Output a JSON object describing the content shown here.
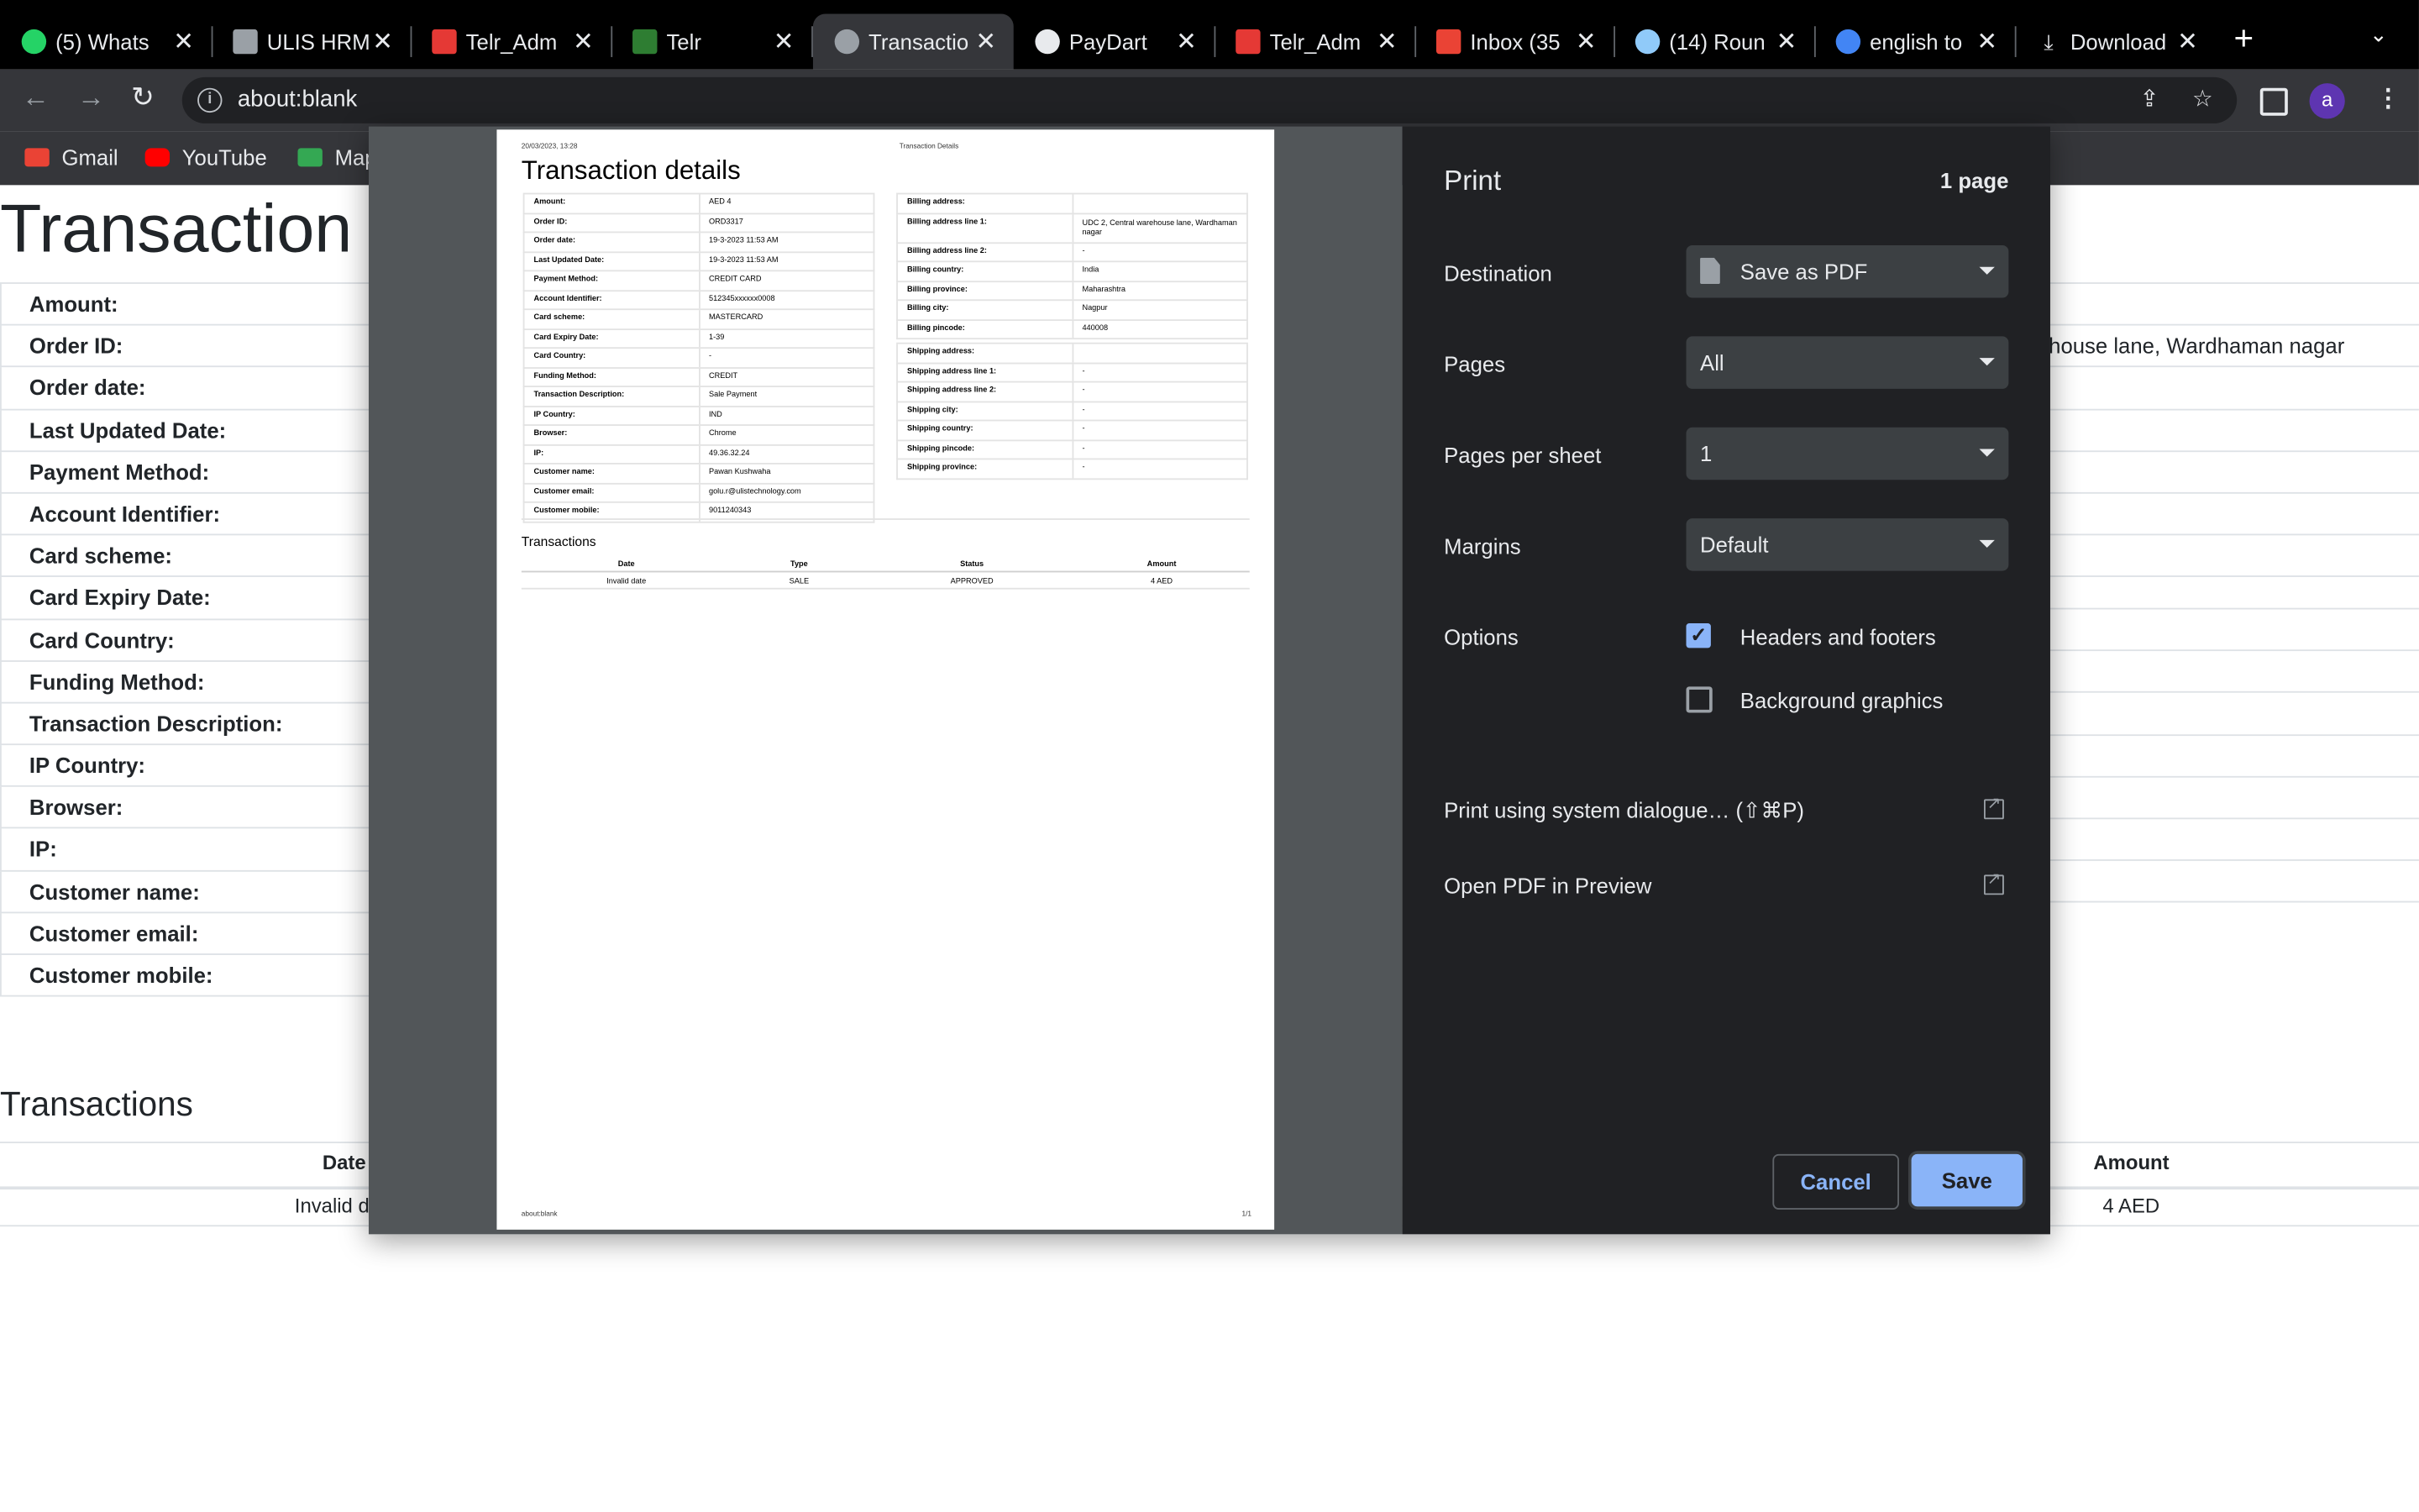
{
  "tabs": [
    {
      "title": "(5) Whats",
      "color": "#25d366",
      "active": false
    },
    {
      "title": "ULIS HRM",
      "color": "#9aa0a6",
      "active": false
    },
    {
      "title": "Telr_Adm",
      "color": "#e53935",
      "active": false
    },
    {
      "title": "Telr",
      "color": "#2e7d32",
      "active": false
    },
    {
      "title": "Transactio",
      "color": "#9aa0a6",
      "active": true
    },
    {
      "title": "PayDart",
      "color": "#e8eaed",
      "active": false
    },
    {
      "title": "Telr_Adm",
      "color": "#e53935",
      "active": false
    },
    {
      "title": "Inbox (35",
      "color": "#ea4335",
      "active": false
    },
    {
      "title": "(14) Roun",
      "color": "#90caf9",
      "active": false
    },
    {
      "title": "english to",
      "color": "#4285f4",
      "active": false
    },
    {
      "title": "Download",
      "color": "#e8eaed",
      "active": false
    }
  ],
  "address_bar": {
    "url": "about:blank"
  },
  "profile": {
    "initial": "a"
  },
  "bookmarks": [
    {
      "label": "Gmail",
      "color": "#ea4335"
    },
    {
      "label": "YouTube",
      "color": "#ff0000"
    },
    {
      "label": "Map",
      "color": "#34a853"
    }
  ],
  "page": {
    "title": "Transaction d",
    "fields": [
      "Amount:",
      "Order ID:",
      "Order date:",
      "Last Updated Date:",
      "Payment Method:",
      "Account Identifier:",
      "Card scheme:",
      "Card Expiry Date:",
      "Card Country:",
      "Funding Method:",
      "Transaction Description:",
      "IP Country:",
      "Browser:",
      "IP:",
      "Customer name:",
      "Customer email:",
      "Customer mobile:"
    ],
    "address_fragment": "house lane, Wardhaman nagar",
    "transactions_heading": "Transactions",
    "col_date": "Date",
    "col_amount": "Amount",
    "row_date": "Invalid d",
    "row_amount": "4 AED"
  },
  "preview": {
    "header_left": "20/03/2023, 13:28",
    "header_center": "Transaction Details",
    "title": "Transaction details",
    "details": [
      [
        "Amount:",
        "AED 4"
      ],
      [
        "Order ID:",
        "ORD3317"
      ],
      [
        "Order date:",
        "19-3-2023 11:53 AM"
      ],
      [
        "Last Updated Date:",
        "19-3-2023 11:53 AM"
      ],
      [
        "Payment Method:",
        "CREDIT CARD"
      ],
      [
        "Account Identifier:",
        "512345xxxxxx0008"
      ],
      [
        "Card scheme:",
        "MASTERCARD"
      ],
      [
        "Card Expiry Date:",
        "1-39"
      ],
      [
        "Card Country:",
        "-"
      ],
      [
        "Funding Method:",
        "CREDIT"
      ],
      [
        "Transaction Description:",
        "Sale Payment"
      ],
      [
        "IP Country:",
        "IND"
      ],
      [
        "Browser:",
        "Chrome"
      ],
      [
        "IP:",
        "49.36.32.24"
      ],
      [
        "Customer name:",
        "Pawan Kushwaha"
      ],
      [
        "Customer email:",
        "golu.r@ulistechnology.com"
      ],
      [
        "Customer mobile:",
        "9011240343"
      ]
    ],
    "billing": [
      [
        "Billing address:",
        ""
      ],
      [
        "Billing address line 1:",
        "UDC 2, Central warehouse lane, Wardhaman nagar"
      ],
      [
        "Billing address line 2:",
        "-"
      ],
      [
        "Billing country:",
        "India"
      ],
      [
        "Billing province:",
        "Maharashtra"
      ],
      [
        "Billing city:",
        "Nagpur"
      ],
      [
        "Billing pincode:",
        "440008"
      ]
    ],
    "shipping": [
      [
        "Shipping address:",
        ""
      ],
      [
        "Shipping address line 1:",
        "-"
      ],
      [
        "Shipping address line 2:",
        "-"
      ],
      [
        "Shipping city:",
        "-"
      ],
      [
        "Shipping country:",
        "-"
      ],
      [
        "Shipping pincode:",
        "-"
      ],
      [
        "Shipping province:",
        "-"
      ]
    ],
    "transactions_heading": "Transactions",
    "trans_headers": [
      "Date",
      "Type",
      "Status",
      "Amount"
    ],
    "trans_row": [
      "Invalid date",
      "SALE",
      "APPROVED",
      "4 AED"
    ],
    "footer_left": "about:blank",
    "footer_right": "1/1"
  },
  "print": {
    "title": "Print",
    "page_count": "1 page",
    "destination_label": "Destination",
    "destination_value": "Save as PDF",
    "pages_label": "Pages",
    "pages_value": "All",
    "pps_label": "Pages per sheet",
    "pps_value": "1",
    "margins_label": "Margins",
    "margins_value": "Default",
    "options_label": "Options",
    "headers_footers": "Headers and footers",
    "headers_footers_checked": true,
    "background_graphics": "Background graphics",
    "background_graphics_checked": false,
    "system_dialog": "Print using system dialogue… (⇧⌘P)",
    "open_pdf": "Open PDF in Preview",
    "cancel": "Cancel",
    "save": "Save"
  }
}
